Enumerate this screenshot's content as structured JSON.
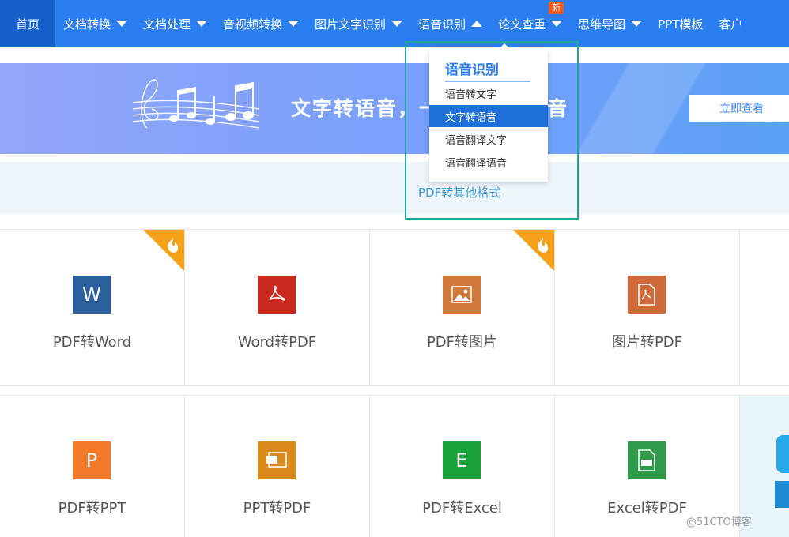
{
  "nav": {
    "items": [
      {
        "label": "首页",
        "caret": "none"
      },
      {
        "label": "文档转换",
        "caret": "down"
      },
      {
        "label": "文档处理",
        "caret": "down"
      },
      {
        "label": "音视频转换",
        "caret": "down"
      },
      {
        "label": "图片文字识别",
        "caret": "down"
      },
      {
        "label": "语音识别",
        "caret": "up"
      },
      {
        "label": "论文查重",
        "caret": "down",
        "badge": "新"
      },
      {
        "label": "思维导图",
        "caret": "down"
      },
      {
        "label": "PPT模板",
        "caret": "none"
      },
      {
        "label": "客户",
        "caret": "none"
      }
    ],
    "colors": {
      "bar": "#2a7ef0",
      "home": "#1560c9",
      "badge": "#f25a1a"
    }
  },
  "banner": {
    "title": "文字转语音，一键添加背景音",
    "button": "立即查看",
    "icon": "music-notes-icon"
  },
  "strip": {
    "link": "PDF转其他格式"
  },
  "dropdown": {
    "title": "语音识别",
    "items": [
      {
        "label": "语音转文字",
        "active": false
      },
      {
        "label": "文字转语音",
        "active": true
      },
      {
        "label": "语音翻译文字",
        "active": false
      },
      {
        "label": "语音翻译语音",
        "active": false
      }
    ]
  },
  "tools": {
    "row1": [
      {
        "label": "PDF转Word",
        "icon": "word-icon",
        "glyph": "W",
        "color": "#2b5f9e",
        "hot": true
      },
      {
        "label": "Word转PDF",
        "icon": "pdf-icon",
        "glyph": "",
        "color": "#c8281e",
        "hot": false
      },
      {
        "label": "PDF转图片",
        "icon": "image-icon",
        "glyph": "",
        "color": "#d0793a",
        "hot": true
      },
      {
        "label": "图片转PDF",
        "icon": "pdf-icon",
        "glyph": "",
        "color": "#d06a3a",
        "hot": false
      }
    ],
    "row2": [
      {
        "label": "PDF转PPT",
        "icon": "ppt-icon",
        "glyph": "P",
        "color": "#f27a28",
        "hot": false
      },
      {
        "label": "PPT转PDF",
        "icon": "ppt-pdf-icon",
        "glyph": "",
        "color": "#d98a1a",
        "hot": false
      },
      {
        "label": "PDF转Excel",
        "icon": "excel-icon",
        "glyph": "E",
        "color": "#1aa33a",
        "hot": false
      },
      {
        "label": "Excel转PDF",
        "icon": "excel-pdf-icon",
        "glyph": "",
        "color": "#2e9a4a",
        "hot": false
      }
    ]
  },
  "watermark": "@51CTO博客"
}
